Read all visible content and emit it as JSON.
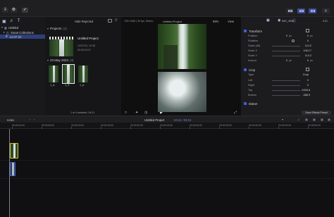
{
  "toolbar": {
    "hide_rejected": "Hide Rejected",
    "format": "720×1280 | 30 fps, Stereo",
    "project_name": "Untitled Project",
    "zoom": "59%",
    "view": "View",
    "inspector_name": "IMG_4508",
    "inspector_duration": "4:21"
  },
  "sidebar": {
    "items": [
      {
        "label": "Untitled",
        "selected": false
      },
      {
        "label": "Smart Collections",
        "selected": false
      },
      {
        "label": "12-07-24",
        "selected": true
      }
    ]
  },
  "browser": {
    "projects_label": "Projects",
    "projects_count": "(1)",
    "project_title": "Untitled Project",
    "project_date": "12/07/24, 13:38",
    "project_duration": "00:00:04:21",
    "date_label": "23 May 2024",
    "date_count": "(3)",
    "clips": [
      "1_8",
      "1_9",
      "1_8"
    ],
    "status": "1 of 4 selected, 04:21"
  },
  "inspector": {
    "transform": "Transform",
    "position": "Position",
    "position_x": "0",
    "position_x_unit": "px",
    "position_y": "0",
    "position_y_unit": "px",
    "rotation": "Rotation",
    "rotation_value": "0",
    "scale_all": "Scale (All)",
    "scale_all_value": "114.2",
    "scale_x": "Scale X",
    "scale_x_value": "108.17",
    "scale_y": "Scale Y",
    "scale_y_value": "114.2",
    "anchor": "Anchor",
    "anchor_x": "0",
    "anchor_x_unit": "px",
    "anchor_y": "0",
    "anchor_y_unit": "px",
    "crop": "Crop",
    "type": "Type",
    "type_value": "Crop",
    "left": "Left",
    "left_value": "0",
    "right": "Right",
    "right_value": "0",
    "top": "Top",
    "top_value": "-1606.8",
    "bottom": "Bottom",
    "bottom_value": "-388.9",
    "distort": "Distort",
    "save_preset": "Save Effects Preset"
  },
  "timeline": {
    "index": "Index",
    "project": "Untitled Project",
    "position": "04:21 / 04:21",
    "timecodes": [
      "00:00:00:00",
      "00:00:05:00",
      "00:00:10:00",
      "00:00:15:00",
      "00:00:20:00",
      "00:00:25:00",
      "00:00:30:00",
      "00:00:35:00",
      "00:00:40:00",
      "00:00:45:00",
      "00:00:50:00",
      "00:00:55:00"
    ]
  },
  "colors": {
    "accent": "#3f62e0",
    "selection": "#2d3f7a",
    "clip_selected": "#d8c028"
  }
}
